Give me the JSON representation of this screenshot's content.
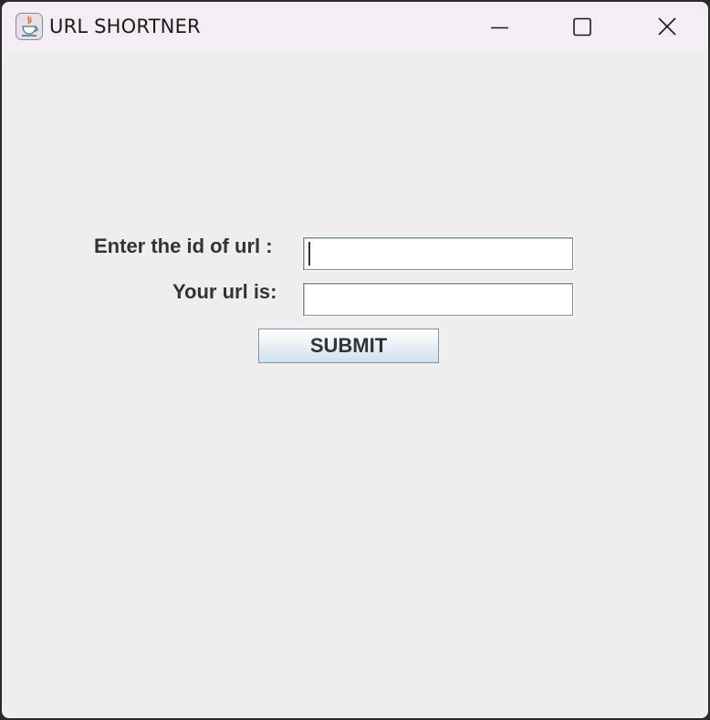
{
  "window": {
    "title": "URL SHORTNER",
    "controls": [
      "minimize",
      "maximize",
      "close"
    ]
  },
  "form": {
    "id_label": "Enter the id of url :",
    "id_value": "",
    "url_label": "Your url is:",
    "url_value": "",
    "submit_label": "SUBMIT"
  },
  "icons": {
    "app": "java-coffee-cup-icon",
    "minimize": "minimize-icon",
    "maximize": "maximize-icon",
    "close": "close-icon"
  },
  "colors": {
    "titlebar_bg": "#f4eef4",
    "content_bg": "#eeeeee",
    "text": "#333333",
    "button_border": "#7d97b0"
  }
}
